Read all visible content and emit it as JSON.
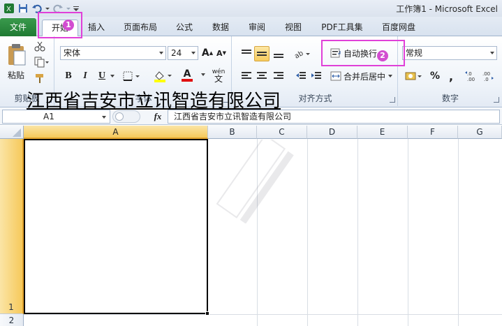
{
  "window": {
    "title": "工作簿1 - Microsoft Excel"
  },
  "tabs": [
    "文件",
    "开始",
    "插入",
    "页面布局",
    "公式",
    "数据",
    "审阅",
    "视图",
    "PDF工具集",
    "百度网盘"
  ],
  "ribbon": {
    "clipboard": {
      "paste_label": "粘贴",
      "group_label": "剪贴板"
    },
    "font": {
      "font_name": "宋体",
      "font_size": "24",
      "bold": "B",
      "italic": "I",
      "underline": "U",
      "font_color_glyph": "A",
      "phonetic_glyph": "wén",
      "grow_glyph": "A",
      "shrink_glyph": "A",
      "group_label": "字体"
    },
    "alignment": {
      "wrap_text_label": "自动换行",
      "merge_center_label": "合并后居中",
      "group_label": "对齐方式"
    },
    "number": {
      "format": "常规",
      "percent": "%",
      "comma": ",",
      "group_label": "数字"
    }
  },
  "formula_bar": {
    "name_box": "A1",
    "fx_label": "fx",
    "content": "江西省吉安市立讯智造有限公司"
  },
  "grid": {
    "columns": [
      "A",
      "B",
      "C",
      "D",
      "E",
      "F",
      "G"
    ],
    "rows": [
      "1",
      "2"
    ],
    "cell_a1": "江西省吉安市立讯智造有限公司"
  },
  "annotations": {
    "badge1": "1",
    "badge2": "2"
  },
  "colors": {
    "file_tab": "#1f7a33",
    "selection_header": "#f6c95b",
    "annotation": "#e040d8"
  }
}
